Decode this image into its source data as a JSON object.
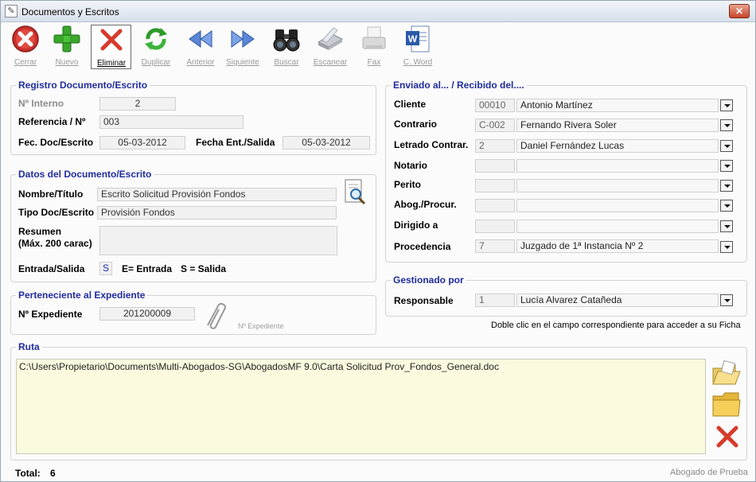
{
  "window": {
    "title": "Documentos y Escritos",
    "close_label": "✕"
  },
  "toolbar": {
    "buttons": [
      {
        "label": "Cerrar",
        "icon": "close-circle-icon"
      },
      {
        "label": "Nuevo",
        "icon": "plus-icon"
      },
      {
        "label": "Eliminar",
        "icon": "red-x-icon"
      },
      {
        "label": "Duplicar",
        "icon": "recycle-arrows-icon"
      },
      {
        "label": "Anterior",
        "icon": "double-left-arrow-icon"
      },
      {
        "label": "Siguiente",
        "icon": "double-right-arrow-icon"
      },
      {
        "label": "Buscar",
        "icon": "binoculars-icon"
      },
      {
        "label": "Escanear",
        "icon": "scanner-icon"
      },
      {
        "label": "Fax",
        "icon": "fax-icon"
      },
      {
        "label": "C. Word",
        "icon": "word-doc-icon"
      }
    ]
  },
  "registro": {
    "title": "Registro Documento/Escrito",
    "interno_label": "Nº Interno",
    "interno_value": "2",
    "referencia_label": "Referencia / Nº",
    "referencia_value": "003",
    "fec_label": "Fec. Doc/Escrito",
    "fec_value": "05-03-2012",
    "fecha_ent_label": "Fecha Ent./Salida",
    "fecha_ent_value": "05-03-2012"
  },
  "datos": {
    "title": "Datos del Documento/Escrito",
    "nombre_label": "Nombre/Título",
    "nombre_value": "Escrito Solicitud Provisión Fondos",
    "tipo_label": "Tipo Doc/Escrito",
    "tipo_value": "Provisión Fondos",
    "resumen_label_1": "Resumen",
    "resumen_label_2": "(Máx. 200 carac)",
    "resumen_value": "",
    "entrada_label": "Entrada/Salida",
    "entrada_value": "S",
    "entrada_hint": "E= Entrada",
    "salida_hint": "S = Salida"
  },
  "expediente": {
    "title": "Perteneciente al Expediente",
    "label": "Nº Expediente",
    "value": "201200009",
    "clip_caption": "Nº Expediente"
  },
  "enviado": {
    "title": "Enviado al... / Recibido del....",
    "rows": [
      {
        "label": "Cliente",
        "code": "00010",
        "name": "Antonio Martínez"
      },
      {
        "label": "Contrario",
        "code": "C-002",
        "name": "Fernando Rivera Soler"
      },
      {
        "label": "Letrado Contrar.",
        "code": "2",
        "name": "Daniel Fernández Lucas"
      },
      {
        "label": "Notario",
        "code": "",
        "name": ""
      },
      {
        "label": "Perito",
        "code": "",
        "name": ""
      },
      {
        "label": "Abog./Procur.",
        "code": "",
        "name": ""
      },
      {
        "label": "Dirigido a",
        "code": "",
        "name": ""
      },
      {
        "label": "Procedencia",
        "code": "7",
        "name": "Juzgado de 1ª Instancia Nº 2"
      }
    ]
  },
  "gestionado": {
    "title": "Gestionado por",
    "label": "Responsable",
    "code": "1",
    "name": "Lucía Alvarez Catañeda",
    "hint": "Doble clic en el campo correspondiente para acceder a su Ficha"
  },
  "ruta": {
    "title": "Ruta",
    "value": "C:\\Users\\Propietario\\Documents\\Multi-Abogados-SG\\AbogadosMF 9.0\\Carta Solicitud Prov_Fondos_General.doc"
  },
  "footer": {
    "total_label": "Total:",
    "total_value": "6",
    "app_name": "Abogado de Prueba"
  },
  "colors": {
    "group_title": "#1f2c9e",
    "ruta_bg": "#fbfadf",
    "field_bg": "#f1f1f1"
  }
}
